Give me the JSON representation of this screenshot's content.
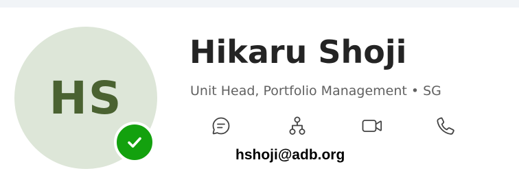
{
  "profile": {
    "initials": "HS",
    "name": "Hikaru Shoji",
    "title_line": "Unit Head, Portfolio Management • SG",
    "email": "hshoji@adb.org",
    "presence_status": "available",
    "presence_color": "#13a10e",
    "avatar_background": "#dde6d8",
    "initials_color": "#4a6231"
  },
  "actions": [
    {
      "icon": "chat-icon"
    },
    {
      "icon": "org-chart-icon"
    },
    {
      "icon": "video-call-icon"
    },
    {
      "icon": "phone-call-icon"
    }
  ]
}
